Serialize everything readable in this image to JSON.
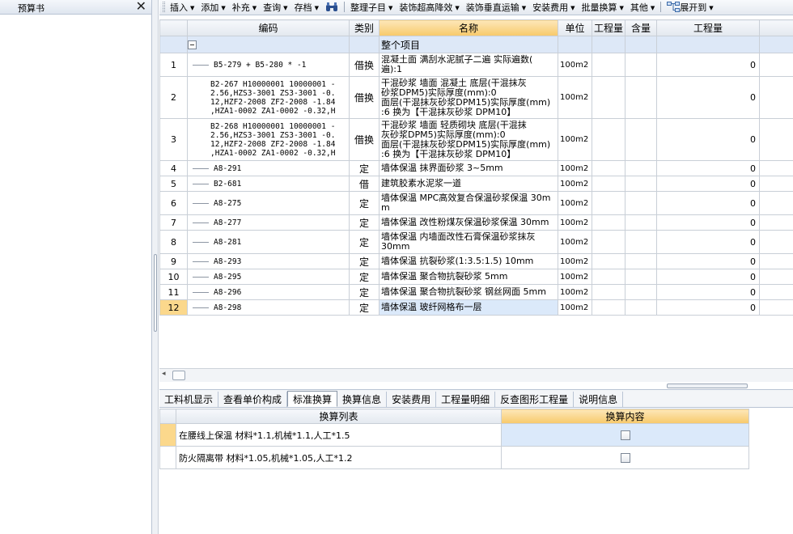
{
  "left_panel": {
    "title": "预算书"
  },
  "toolbar": [
    {
      "label": "插入",
      "dropdown": true
    },
    {
      "label": "添加",
      "dropdown": true
    },
    {
      "label": "补充",
      "dropdown": true
    },
    {
      "label": "查询",
      "dropdown": true
    },
    {
      "label": "存档",
      "dropdown": true
    },
    {
      "label": "",
      "icon": "binoculars-icon",
      "dropdown": false
    },
    {
      "label": "整理子目",
      "dropdown": true
    },
    {
      "label": "装饰超高降效",
      "dropdown": true
    },
    {
      "label": "装饰垂直运输",
      "dropdown": true
    },
    {
      "label": "安装费用",
      "dropdown": true
    },
    {
      "label": "批量换算",
      "dropdown": true
    },
    {
      "label": "其他",
      "dropdown": true
    },
    {
      "label": "展开到",
      "icon": "tree-expand-icon",
      "dropdown": true
    }
  ],
  "grid": {
    "columns": [
      "编码",
      "类别",
      "名称",
      "单位",
      "工程量",
      "含量",
      "工程量"
    ],
    "project_row": {
      "name": "整个项目"
    },
    "rows": [
      {
        "no": "1",
        "code": [
          "B5-279 + B5-280 * -1"
        ],
        "cat": "借换",
        "name": [
          "混凝土面 满刮水泥腻子二遍 实际遍数(",
          "遍):1"
        ],
        "unit": "100m2",
        "qty": "0"
      },
      {
        "no": "2",
        "code": [
          "B2-267 H10000001 10000001 -",
          "2.56,HZS3-3001 ZS3-3001 -0.",
          "12,HZF2-2008 ZF2-2008 -1.84",
          ",HZA1-0002 ZA1-0002 -0.32,H"
        ],
        "cat": "借换",
        "name": [
          "干混砂浆 墙面 混凝土 底层(干混抹灰",
          "砂浆DPM5)实际厚度(mm):0",
          "面层(干混抹灰砂浆DPM15)实际厚度(mm)",
          ":6 换为【干混抹灰砂浆 DPM10】"
        ],
        "unit": "100m2",
        "qty": "0"
      },
      {
        "no": "3",
        "code": [
          "B2-268 H10000001 10000001 -",
          "2.56,HZS3-3001 ZS3-3001 -0.",
          "12,HZF2-2008 ZF2-2008 -1.84",
          ",HZA1-0002 ZA1-0002 -0.32,H"
        ],
        "cat": "借换",
        "name": [
          "干混砂浆 墙面 轻质砌块 底层(干混抹",
          "灰砂浆DPM5)实际厚度(mm):0",
          "面层(干混抹灰砂浆DPM15)实际厚度(mm)",
          ":6 换为【干混抹灰砂浆 DPM10】"
        ],
        "unit": "100m2",
        "qty": "0"
      },
      {
        "no": "4",
        "code": [
          "A8-291"
        ],
        "cat": "定",
        "name": [
          "墙体保温 抹界面砂浆 3~5mm"
        ],
        "unit": "100m2",
        "qty": "0"
      },
      {
        "no": "5",
        "code": [
          "B2-681"
        ],
        "cat": "借",
        "name": [
          "建筑胶素水泥浆一道"
        ],
        "unit": "100m2",
        "qty": "0"
      },
      {
        "no": "6",
        "code": [
          "A8-275"
        ],
        "cat": "定",
        "name": [
          "墙体保温 MPC高效复合保温砂浆保温 30m",
          "m"
        ],
        "unit": "100m2",
        "qty": "0"
      },
      {
        "no": "7",
        "code": [
          "A8-277"
        ],
        "cat": "定",
        "name": [
          "墙体保温 改性粉煤灰保温砂浆保温 30mm"
        ],
        "unit": "100m2",
        "qty": "0"
      },
      {
        "no": "8",
        "code": [
          "A8-281"
        ],
        "cat": "定",
        "name": [
          "墙体保温 内墙面改性石膏保温砂浆抹灰",
          "30mm"
        ],
        "unit": "100m2",
        "qty": "0"
      },
      {
        "no": "9",
        "code": [
          "A8-293"
        ],
        "cat": "定",
        "name": [
          "墙体保温 抗裂砂浆(1:3.5:1.5) 10mm"
        ],
        "unit": "100m2",
        "qty": "0"
      },
      {
        "no": "10",
        "code": [
          "A8-295"
        ],
        "cat": "定",
        "name": [
          "墙体保温 聚合物抗裂砂浆 5mm"
        ],
        "unit": "100m2",
        "qty": "0"
      },
      {
        "no": "11",
        "code": [
          "A8-296"
        ],
        "cat": "定",
        "name": [
          "墙体保温 聚合物抗裂砂浆 钢丝网面 5mm"
        ],
        "unit": "100m2",
        "qty": "0"
      },
      {
        "no": "12",
        "code": [
          "A8-298"
        ],
        "cat": "定",
        "name": [
          "墙体保温 玻纤网格布一层"
        ],
        "unit": "100m2",
        "qty": "0",
        "selected": true
      }
    ]
  },
  "tabs": [
    {
      "label": "工料机显示",
      "active": false
    },
    {
      "label": "查看单价构成",
      "active": false
    },
    {
      "label": "标准换算",
      "active": true
    },
    {
      "label": "换算信息",
      "active": false
    },
    {
      "label": "安装费用",
      "active": false
    },
    {
      "label": "工程量明细",
      "active": false
    },
    {
      "label": "反查图形工程量",
      "active": false
    },
    {
      "label": "说明信息",
      "active": false
    }
  ],
  "lower": {
    "columns": [
      "换算列表",
      "换算内容"
    ],
    "rows": [
      {
        "label": "在腰线上保温 材料*1.1,机械*1.1,人工*1.5",
        "checked": false,
        "selected": true
      },
      {
        "label": "防火隔离带 材料*1.05,机械*1.05,人工*1.2",
        "checked": false,
        "selected": false
      }
    ]
  }
}
